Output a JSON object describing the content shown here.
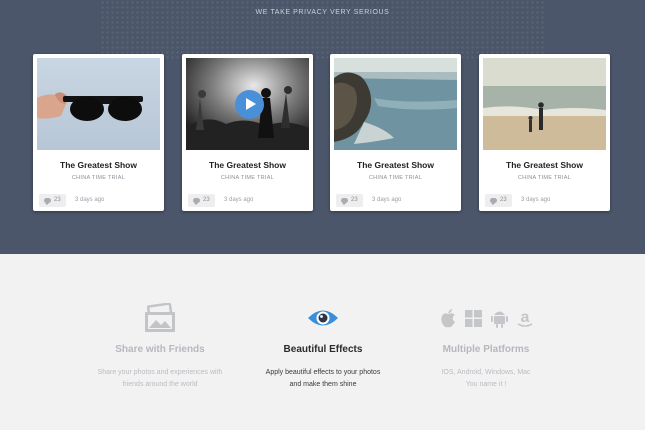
{
  "hero": {
    "tagline": "WE TAKE PRIVACY VERY SERIOUS"
  },
  "cards": [
    {
      "title": "The Greatest Show",
      "subtitle": "CHINA TIME TRIAL",
      "comments": "23",
      "ago": "3 days ago"
    },
    {
      "title": "The Greatest Show",
      "subtitle": "CHINA TIME TRIAL",
      "comments": "23",
      "ago": "3 days ago"
    },
    {
      "title": "The Greatest Show",
      "subtitle": "CHINA TIME TRIAL",
      "comments": "23",
      "ago": "3 days ago"
    },
    {
      "title": "The Greatest Show",
      "subtitle": "CHINA TIME TRIAL",
      "comments": "23",
      "ago": "3 days ago"
    }
  ],
  "features": [
    {
      "title": "Share with Friends",
      "line1": "Share your photos and experiences with",
      "line2": "friends around the world",
      "icon": "photos-icon"
    },
    {
      "title": "Beautiful Effects",
      "line1": "Apply beautiful effects to your photos",
      "line2": "and make them shine",
      "icon": "eye-icon"
    },
    {
      "title": "Multiple Platforms",
      "line1": "IOS, Android, Windows, Mac",
      "line2": "You name it !",
      "icon": "platforms-icons"
    }
  ],
  "colors": {
    "hero_bg": "#4b566a",
    "accent": "#4a90d9",
    "features_bg": "#f2f2f2"
  }
}
